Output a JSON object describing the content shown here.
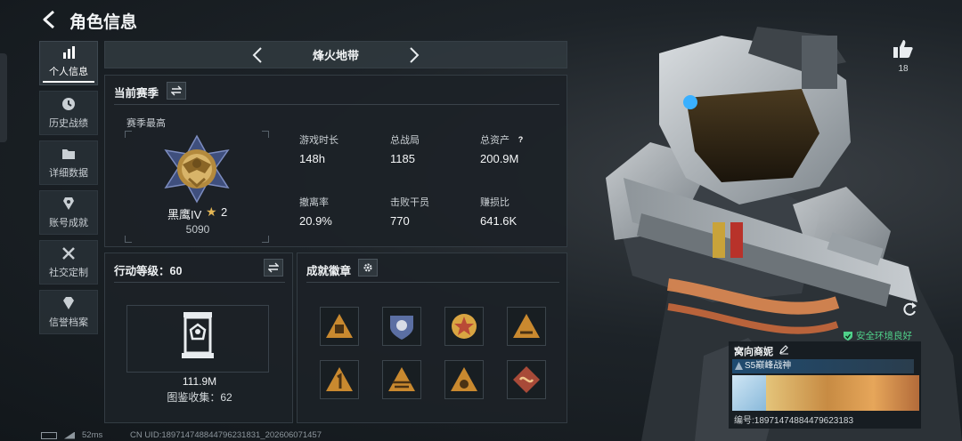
{
  "header": {
    "title": "角色信息"
  },
  "nav": [
    {
      "label": "个人信息",
      "icon": "bar-chart-icon",
      "active": true
    },
    {
      "label": "历史战绩",
      "icon": "clock-icon"
    },
    {
      "label": "详细数据",
      "icon": "folder-icon"
    },
    {
      "label": "账号成就",
      "icon": "achievement-icon"
    },
    {
      "label": "社交定制",
      "icon": "tools-icon"
    },
    {
      "label": "信誉档案",
      "icon": "diamond-icon"
    }
  ],
  "mode_selector": {
    "label": "烽火地带"
  },
  "season_panel": {
    "title": "当前赛季",
    "season_high_label": "赛季最高",
    "rank": {
      "name": "黑鹰IV",
      "stars": "2",
      "points": "5090"
    },
    "stats": [
      {
        "label": "游戏时长",
        "value": "148h"
      },
      {
        "label": "总战局",
        "value": "1185"
      },
      {
        "label": "总资产",
        "value": "200.9M",
        "help": "?"
      },
      {
        "label": "撤离率",
        "value": "20.9%"
      },
      {
        "label": "击败干员",
        "value": "770"
      },
      {
        "label": "赚损比",
        "value": "641.6K"
      }
    ]
  },
  "action_panel": {
    "title": "行动等级：60",
    "collection_value": "111.9M",
    "collection_count_label": "图鉴收集：62"
  },
  "badges_panel": {
    "title": "成就徽章",
    "medals": [
      {
        "icon": "bag-medal-icon",
        "color": "#c9892f"
      },
      {
        "icon": "shield-medal-icon",
        "color": "#5b6fa3"
      },
      {
        "icon": "star-medal-icon",
        "color": "#b94a36"
      },
      {
        "icon": "cut-medal-icon",
        "color": "#c9892f"
      },
      {
        "icon": "number-one-medal-icon",
        "color": "#c9892f"
      },
      {
        "icon": "stripes-medal-icon",
        "color": "#c9892f"
      },
      {
        "icon": "grenade-medal-icon",
        "color": "#c9892f"
      },
      {
        "icon": "dragon-medal-icon",
        "color": "#a84a38"
      }
    ]
  },
  "social": {
    "like_count": "18"
  },
  "safe_badge": {
    "label": "安全环境良好",
    "color": "#4fd18a"
  },
  "player_card": {
    "name": "窝向商妮",
    "title": "S5巅峰战神",
    "uid": "编号:18971474884479623183"
  },
  "footer": {
    "ping": "52ms",
    "uid_text": "CN UID:18971474884479623183​1_202606071457"
  }
}
